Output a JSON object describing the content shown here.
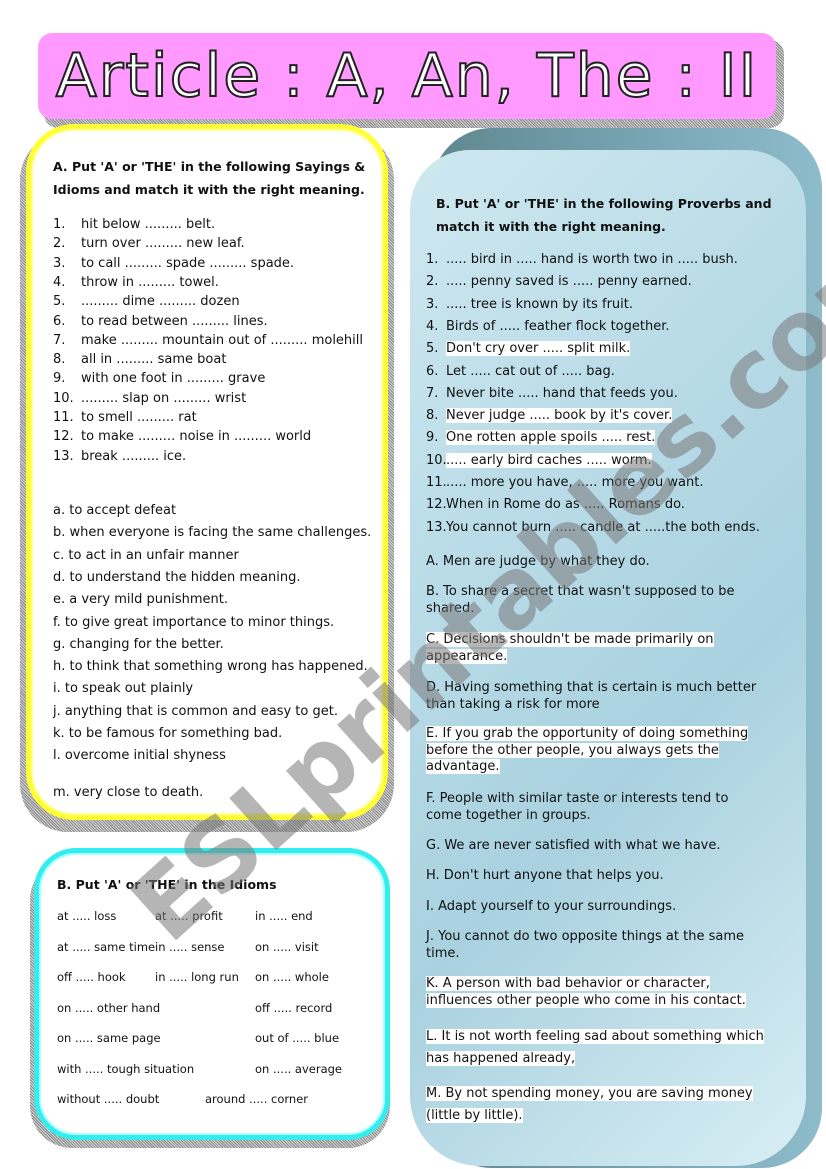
{
  "title": "Article : A, An, The : II",
  "colors": {
    "title_bg": "#ff99ff",
    "box_a_border": "#ffff33",
    "box_c_border": "#33eeee",
    "box_b_bg": "#b8dbe7"
  },
  "section_a": {
    "heading_line1": "A. Put 'A' or 'THE' in the following Sayings &",
    "heading_line2": "Idioms and match it with the right meaning.",
    "items": [
      {
        "num": "1.",
        "text": "hit below .........   belt."
      },
      {
        "num": "2.",
        "text": "turn over ......... new leaf."
      },
      {
        "num": "3.",
        "text": "to call ......... spade .........   spade."
      },
      {
        "num": "4.",
        "text": "throw in .........  towel."
      },
      {
        "num": "5.",
        "text": "......... dime ......... dozen"
      },
      {
        "num": "6.",
        "text": "to read between .........  lines."
      },
      {
        "num": "7.",
        "text": "make .........   mountain out of .........   molehill"
      },
      {
        "num": "8.",
        "text": "all in .........   same boat"
      },
      {
        "num": "9.",
        "text": "with one foot in .........   grave"
      },
      {
        "num": "10.",
        "text": ".........  slap on ......... wrist"
      },
      {
        "num": "11.",
        "text": "to smell .........   rat"
      },
      {
        "num": "12.",
        "text": "to make .........   noise in .........   world"
      },
      {
        "num": "13.",
        "text": "break .........   ice."
      }
    ],
    "meanings": [
      "a. to accept defeat",
      "b. when everyone is facing the same challenges.",
      "c. to act in an unfair manner",
      "d. to understand the hidden meaning.",
      "e. a very mild punishment.",
      "f. to give great importance to minor things.",
      "g. changing for the better.",
      "h. to think that something wrong has happened.",
      "i. to speak out plainly",
      "j. anything that is common and easy to get.",
      "k. to be famous for something bad.",
      "l. overcome initial shyness",
      "m. very close to death."
    ]
  },
  "section_c": {
    "heading": "B. Put 'A' or 'THE' in the Idioms",
    "rows": [
      [
        "at .....  loss",
        "at .....  profit",
        "in .....  end"
      ],
      [
        "at .....  same time",
        "in .....  sense",
        "on .....  visit"
      ],
      [
        "off .....  hook",
        "in .....  long run",
        "on .....  whole"
      ],
      [
        "on .....  other hand",
        "",
        "off ..... record"
      ],
      [
        "on .....  same page",
        "",
        "out of .....  blue"
      ],
      [
        "with .....  tough situation",
        "",
        "on .....  average"
      ],
      [
        "without .....  doubt",
        "around .....  corner",
        ""
      ]
    ]
  },
  "section_b": {
    "heading_line1": "B. Put 'A' or 'THE' in the following Proverbs and",
    "heading_line2": "match it with the right meaning.",
    "proverbs": [
      {
        "num": "1.",
        "text": ".....   bird in  ..... hand is worth two in  ..... bush."
      },
      {
        "num": "2.",
        "text": ".....  penny saved is  .....  penny earned."
      },
      {
        "num": "3.",
        "text": ".....  tree is known by its fruit."
      },
      {
        "num": "4.",
        "text": "Birds of  .....   feather flock together."
      },
      {
        "num": "5.",
        "text": "Don't cry over  .....   split milk."
      },
      {
        "num": "6.",
        "text": "Let  .....   cat out of .....  bag."
      },
      {
        "num": "7.",
        "text": "Never bite .....  hand that feeds you."
      },
      {
        "num": "8.",
        "text": "Never judge  .....   book by it's cover."
      },
      {
        "num": "9.",
        "text": "One rotten apple spoils .....   rest."
      },
      {
        "num": "10.",
        "text": ".....   early bird caches .....   worm."
      },
      {
        "num": "11.",
        "text": ".....  more you have, ..... more you want."
      },
      {
        "num": "12.",
        "text": "When in Rome do as ..... Romans do."
      },
      {
        "num": "13.",
        "text": "You cannot burn ..... candle at .....the both ends."
      }
    ],
    "meanings": [
      "A. Men are judge by what they do.",
      "B. To share a secret that wasn't supposed to be shared.",
      "C. Decisions shouldn't be made primarily on appearance.",
      "D. Having something that is certain is much better than taking a risk for more",
      "E. If you grab the opportunity of doing something before the other people, you always gets the advantage.",
      "F. People with similar taste or interests tend to come together in groups.",
      "G. We are never satisfied with what we have.",
      "H. Don't hurt anyone that helps you.",
      "I. Adapt yourself to your surroundings.",
      "J. You cannot do two opposite things at the same time.",
      "K. A person with bad behavior or character, influences other people who come in his contact.",
      "L. It is not worth feeling sad about something which has happened already,",
      "M. By not spending money, you are saving money (little by little)."
    ]
  },
  "watermark": "ESLprintables.com"
}
